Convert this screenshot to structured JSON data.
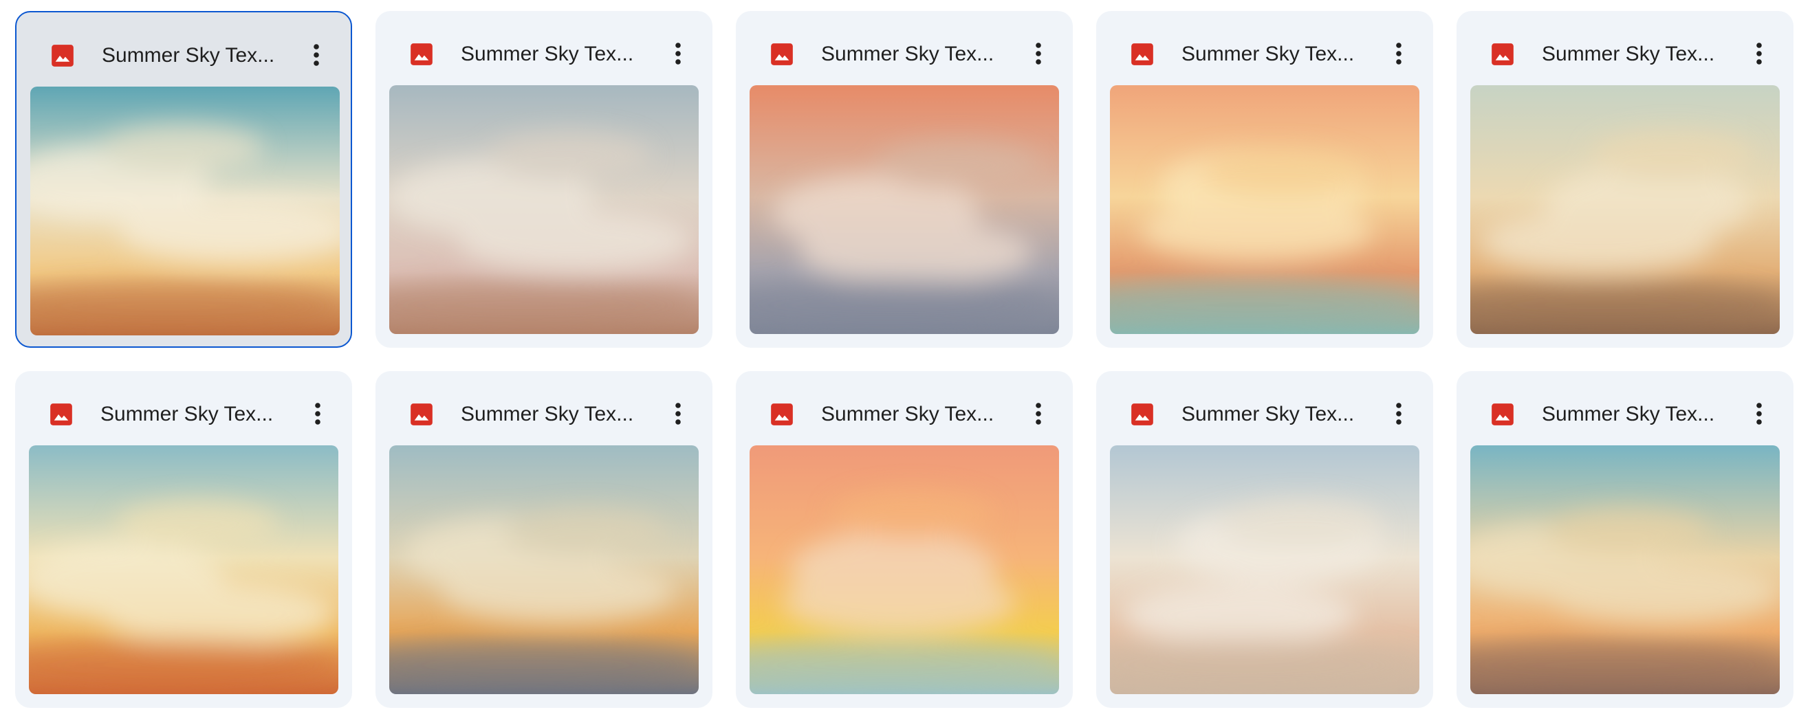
{
  "files": [
    {
      "title": "Summer Sky Tex...",
      "icon": "image-file-icon",
      "selected": true,
      "palette": {
        "top": "#5fa6b4",
        "mid": "#e9e2c9",
        "low": "#f2c984",
        "bottom": "#c0703f",
        "haze": "#f7efdc"
      }
    },
    {
      "title": "Summer Sky Tex...",
      "icon": "image-file-icon",
      "selected": false,
      "palette": {
        "top": "#a7b8c0",
        "mid": "#ddd3c6",
        "low": "#dcbfb5",
        "bottom": "#b4836a",
        "haze": "#eee7dc"
      }
    },
    {
      "title": "Summer Sky Tex...",
      "icon": "image-file-icon",
      "selected": false,
      "palette": {
        "top": "#e78b68",
        "mid": "#d8b7a3",
        "low": "#a5a3ad",
        "bottom": "#7f8697",
        "haze": "#f0ded0"
      }
    },
    {
      "title": "Summer Sky Tex...",
      "icon": "image-file-icon",
      "selected": false,
      "palette": {
        "top": "#f0a57a",
        "mid": "#f7d59a",
        "low": "#e49a6d",
        "bottom": "#89b8b0",
        "haze": "#fbe6b8"
      }
    },
    {
      "title": "Summer Sky Tex...",
      "icon": "image-file-icon",
      "selected": false,
      "palette": {
        "top": "#c7d3c4",
        "mid": "#ecd9b2",
        "low": "#e3b078",
        "bottom": "#8f6a4f",
        "haze": "#f3e7cd"
      }
    },
    {
      "title": "Summer Sky Tex...",
      "icon": "image-file-icon",
      "selected": false,
      "palette": {
        "top": "#8cbcc6",
        "mid": "#efe1b6",
        "low": "#efb861",
        "bottom": "#d06a37",
        "haze": "#f6edd0"
      }
    },
    {
      "title": "Summer Sky Tex...",
      "icon": "image-file-icon",
      "selected": false,
      "palette": {
        "top": "#9fbcc3",
        "mid": "#ded3b5",
        "low": "#e7a659",
        "bottom": "#6f7481",
        "haze": "#efe4c9"
      }
    },
    {
      "title": "Summer Sky Tex...",
      "icon": "image-file-icon",
      "selected": false,
      "palette": {
        "top": "#f09a79",
        "mid": "#f6b479",
        "low": "#f4cd50",
        "bottom": "#9fc3c4",
        "haze": "#f3dac0"
      }
    },
    {
      "title": "Summer Sky Tex...",
      "icon": "image-file-icon",
      "selected": false,
      "palette": {
        "top": "#b3c7d3",
        "mid": "#ece3d3",
        "low": "#e4c1a6",
        "bottom": "#cdb7a2",
        "haze": "#f3ece2"
      }
    },
    {
      "title": "Summer Sky Tex...",
      "icon": "image-file-icon",
      "selected": false,
      "palette": {
        "top": "#79b5c3",
        "mid": "#e9d3a6",
        "low": "#efad6c",
        "bottom": "#8d6b5b",
        "haze": "#f0e1bf"
      }
    }
  ],
  "menu_icon": "more-vert-icon",
  "colors": {
    "accent": "#0b57d0",
    "file_icon": "#d93025"
  }
}
